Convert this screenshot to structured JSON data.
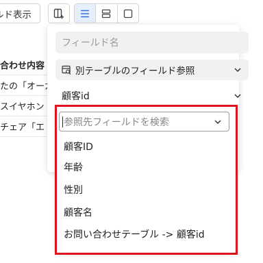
{
  "toolbar": {
    "field_display_label": "ルド表示"
  },
  "background_table": {
    "header": "合わせ内容",
    "rows": [
      "たの「オーガ",
      "スイヤホン",
      "チェア「エ"
    ]
  },
  "popover": {
    "field_name_placeholder": "フィールド名",
    "field_type_label": "別テーブルのフィールド参照",
    "selected_field": "顧客id"
  },
  "dropdown": {
    "search_placeholder": "参照先フィールドを検索",
    "options": [
      "顧客ID",
      "年齢",
      "性別",
      "顧客名",
      "お問い合わせテーブル -> 顧客id"
    ]
  },
  "colors": {
    "highlight": "#e0131d",
    "active_view": "#e6f0fc",
    "accent": "#2f6fd6"
  }
}
